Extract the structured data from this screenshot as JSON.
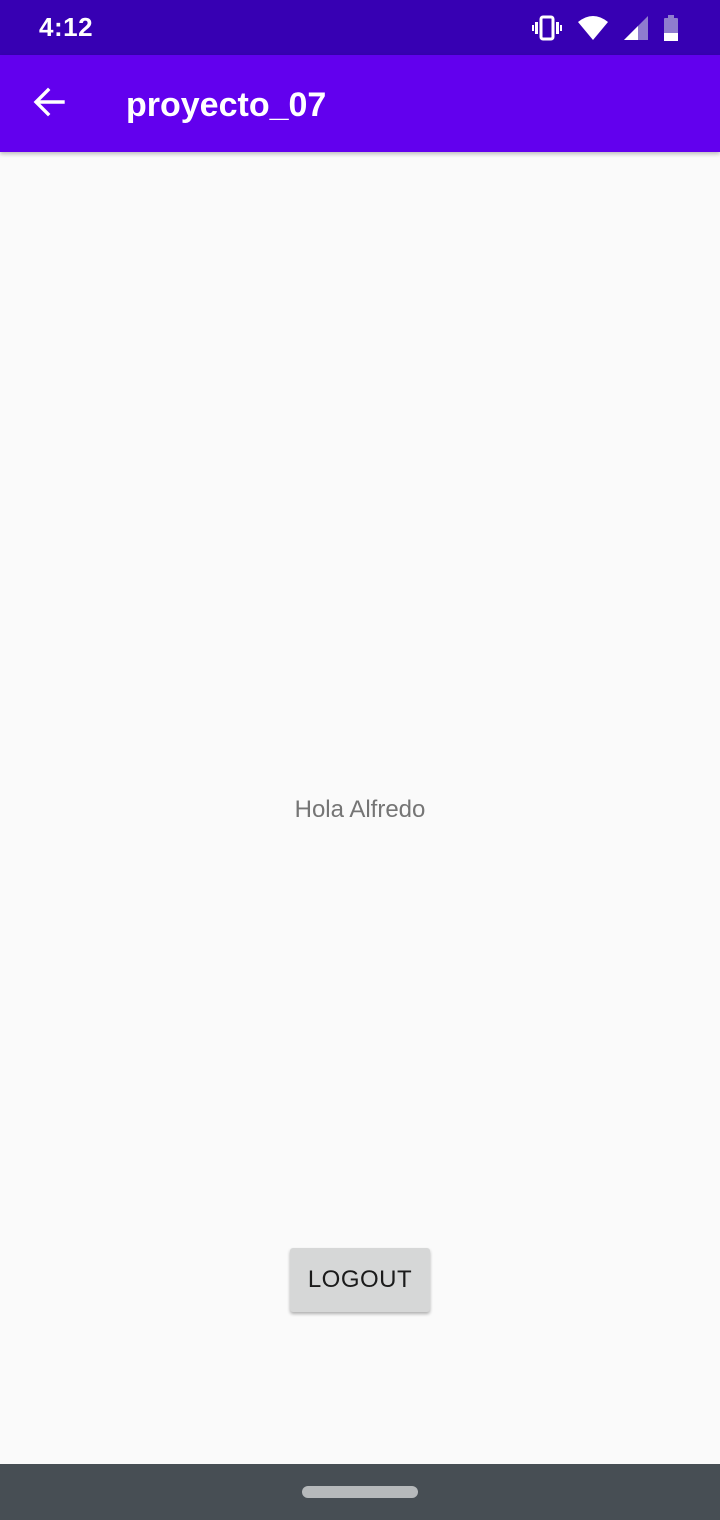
{
  "status_bar": {
    "time": "4:12",
    "icons": [
      "vibrate-icon",
      "wifi-icon",
      "signal-icon",
      "battery-icon"
    ]
  },
  "app_bar": {
    "back_icon": "arrow-back-icon",
    "title": "proyecto_07",
    "color": "#6200ee"
  },
  "main": {
    "greeting": "Hola Alfredo",
    "logout_label": "LOGOUT"
  },
  "colors": {
    "status_bar": "#3700b3",
    "app_bar": "#6200ee",
    "background": "#fafafa",
    "button": "#d6d7d7",
    "nav_bar": "#474e54"
  }
}
